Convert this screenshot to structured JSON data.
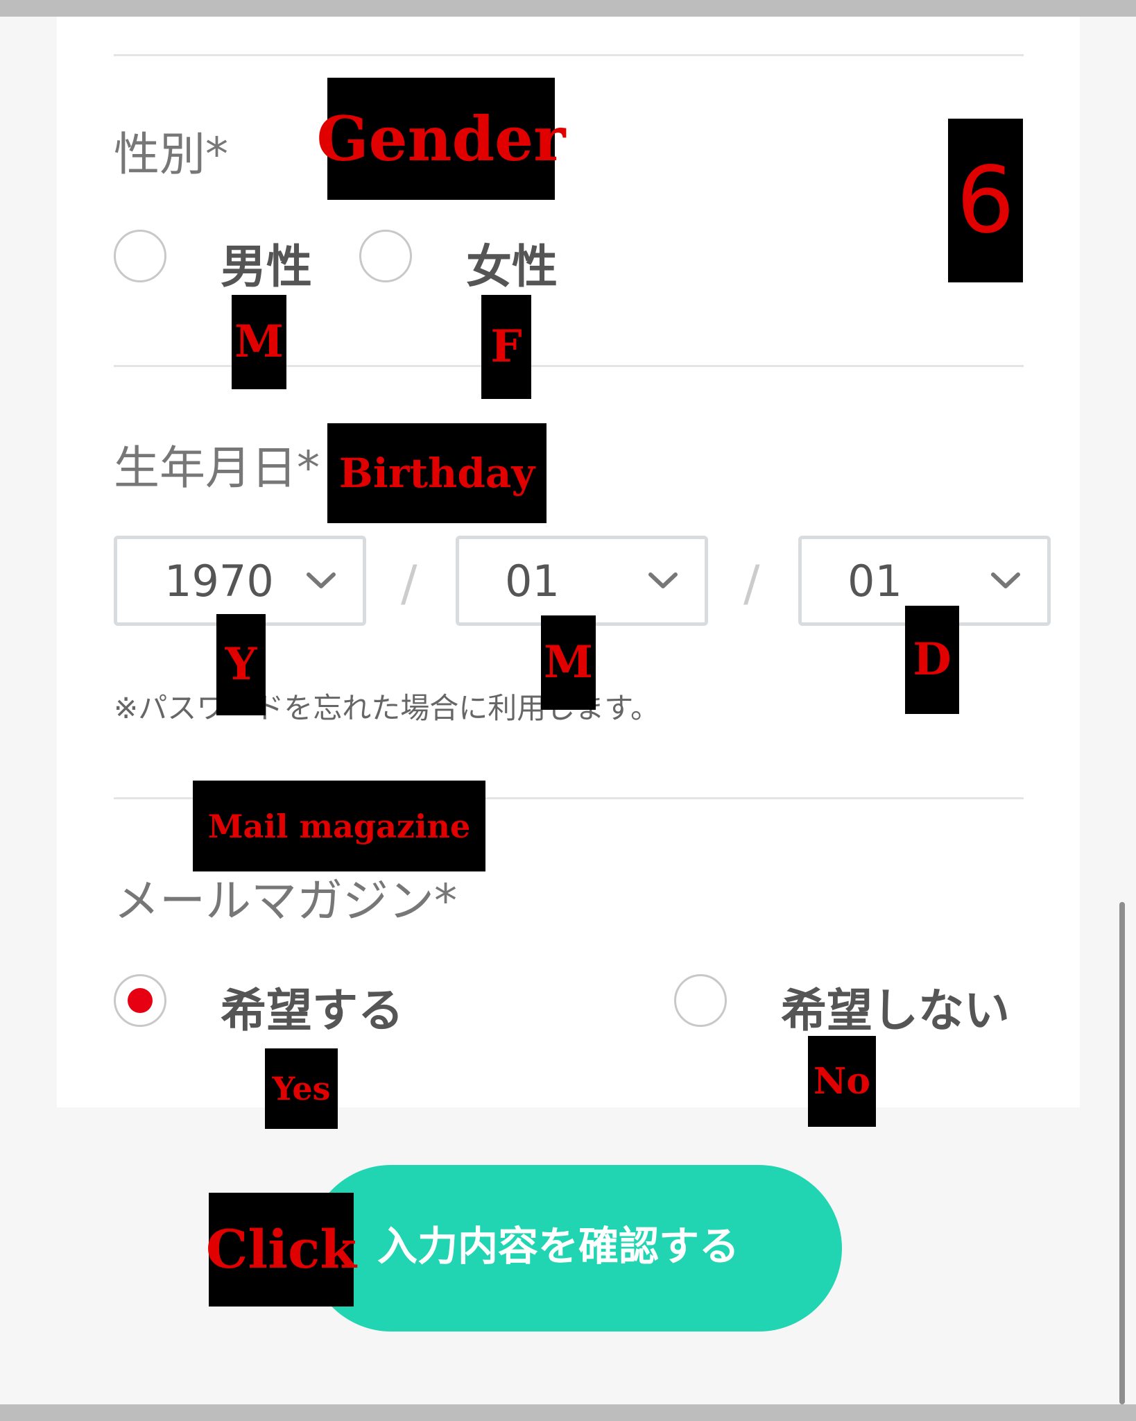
{
  "gender": {
    "label": "性別*",
    "options": [
      {
        "label": "男性",
        "selected": false
      },
      {
        "label": "女性",
        "selected": false
      }
    ]
  },
  "birthday": {
    "label": "生年月日*",
    "year": "1970",
    "month": "01",
    "day": "01",
    "separator": "/",
    "note": "※パスワードを忘れた場合に利用します。"
  },
  "newsletter": {
    "label": "メールマガジン*",
    "options": [
      {
        "label": "希望する",
        "selected": true
      },
      {
        "label": "希望しない",
        "selected": false
      }
    ]
  },
  "submit": {
    "label": "入力内容を確認する"
  },
  "annotations": {
    "gender": "Gender",
    "step": "6",
    "male": "M",
    "female": "F",
    "birthday": "Birthday",
    "year": "Y",
    "month": "M",
    "day": "D",
    "mail_magazine": "Mail magazine",
    "yes": "Yes",
    "no": "No",
    "click": "Click"
  },
  "colors": {
    "accent": "#22d5b2",
    "radio_selected": "#e60012",
    "annotation_text": "#e00000",
    "annotation_bg": "#000000"
  }
}
